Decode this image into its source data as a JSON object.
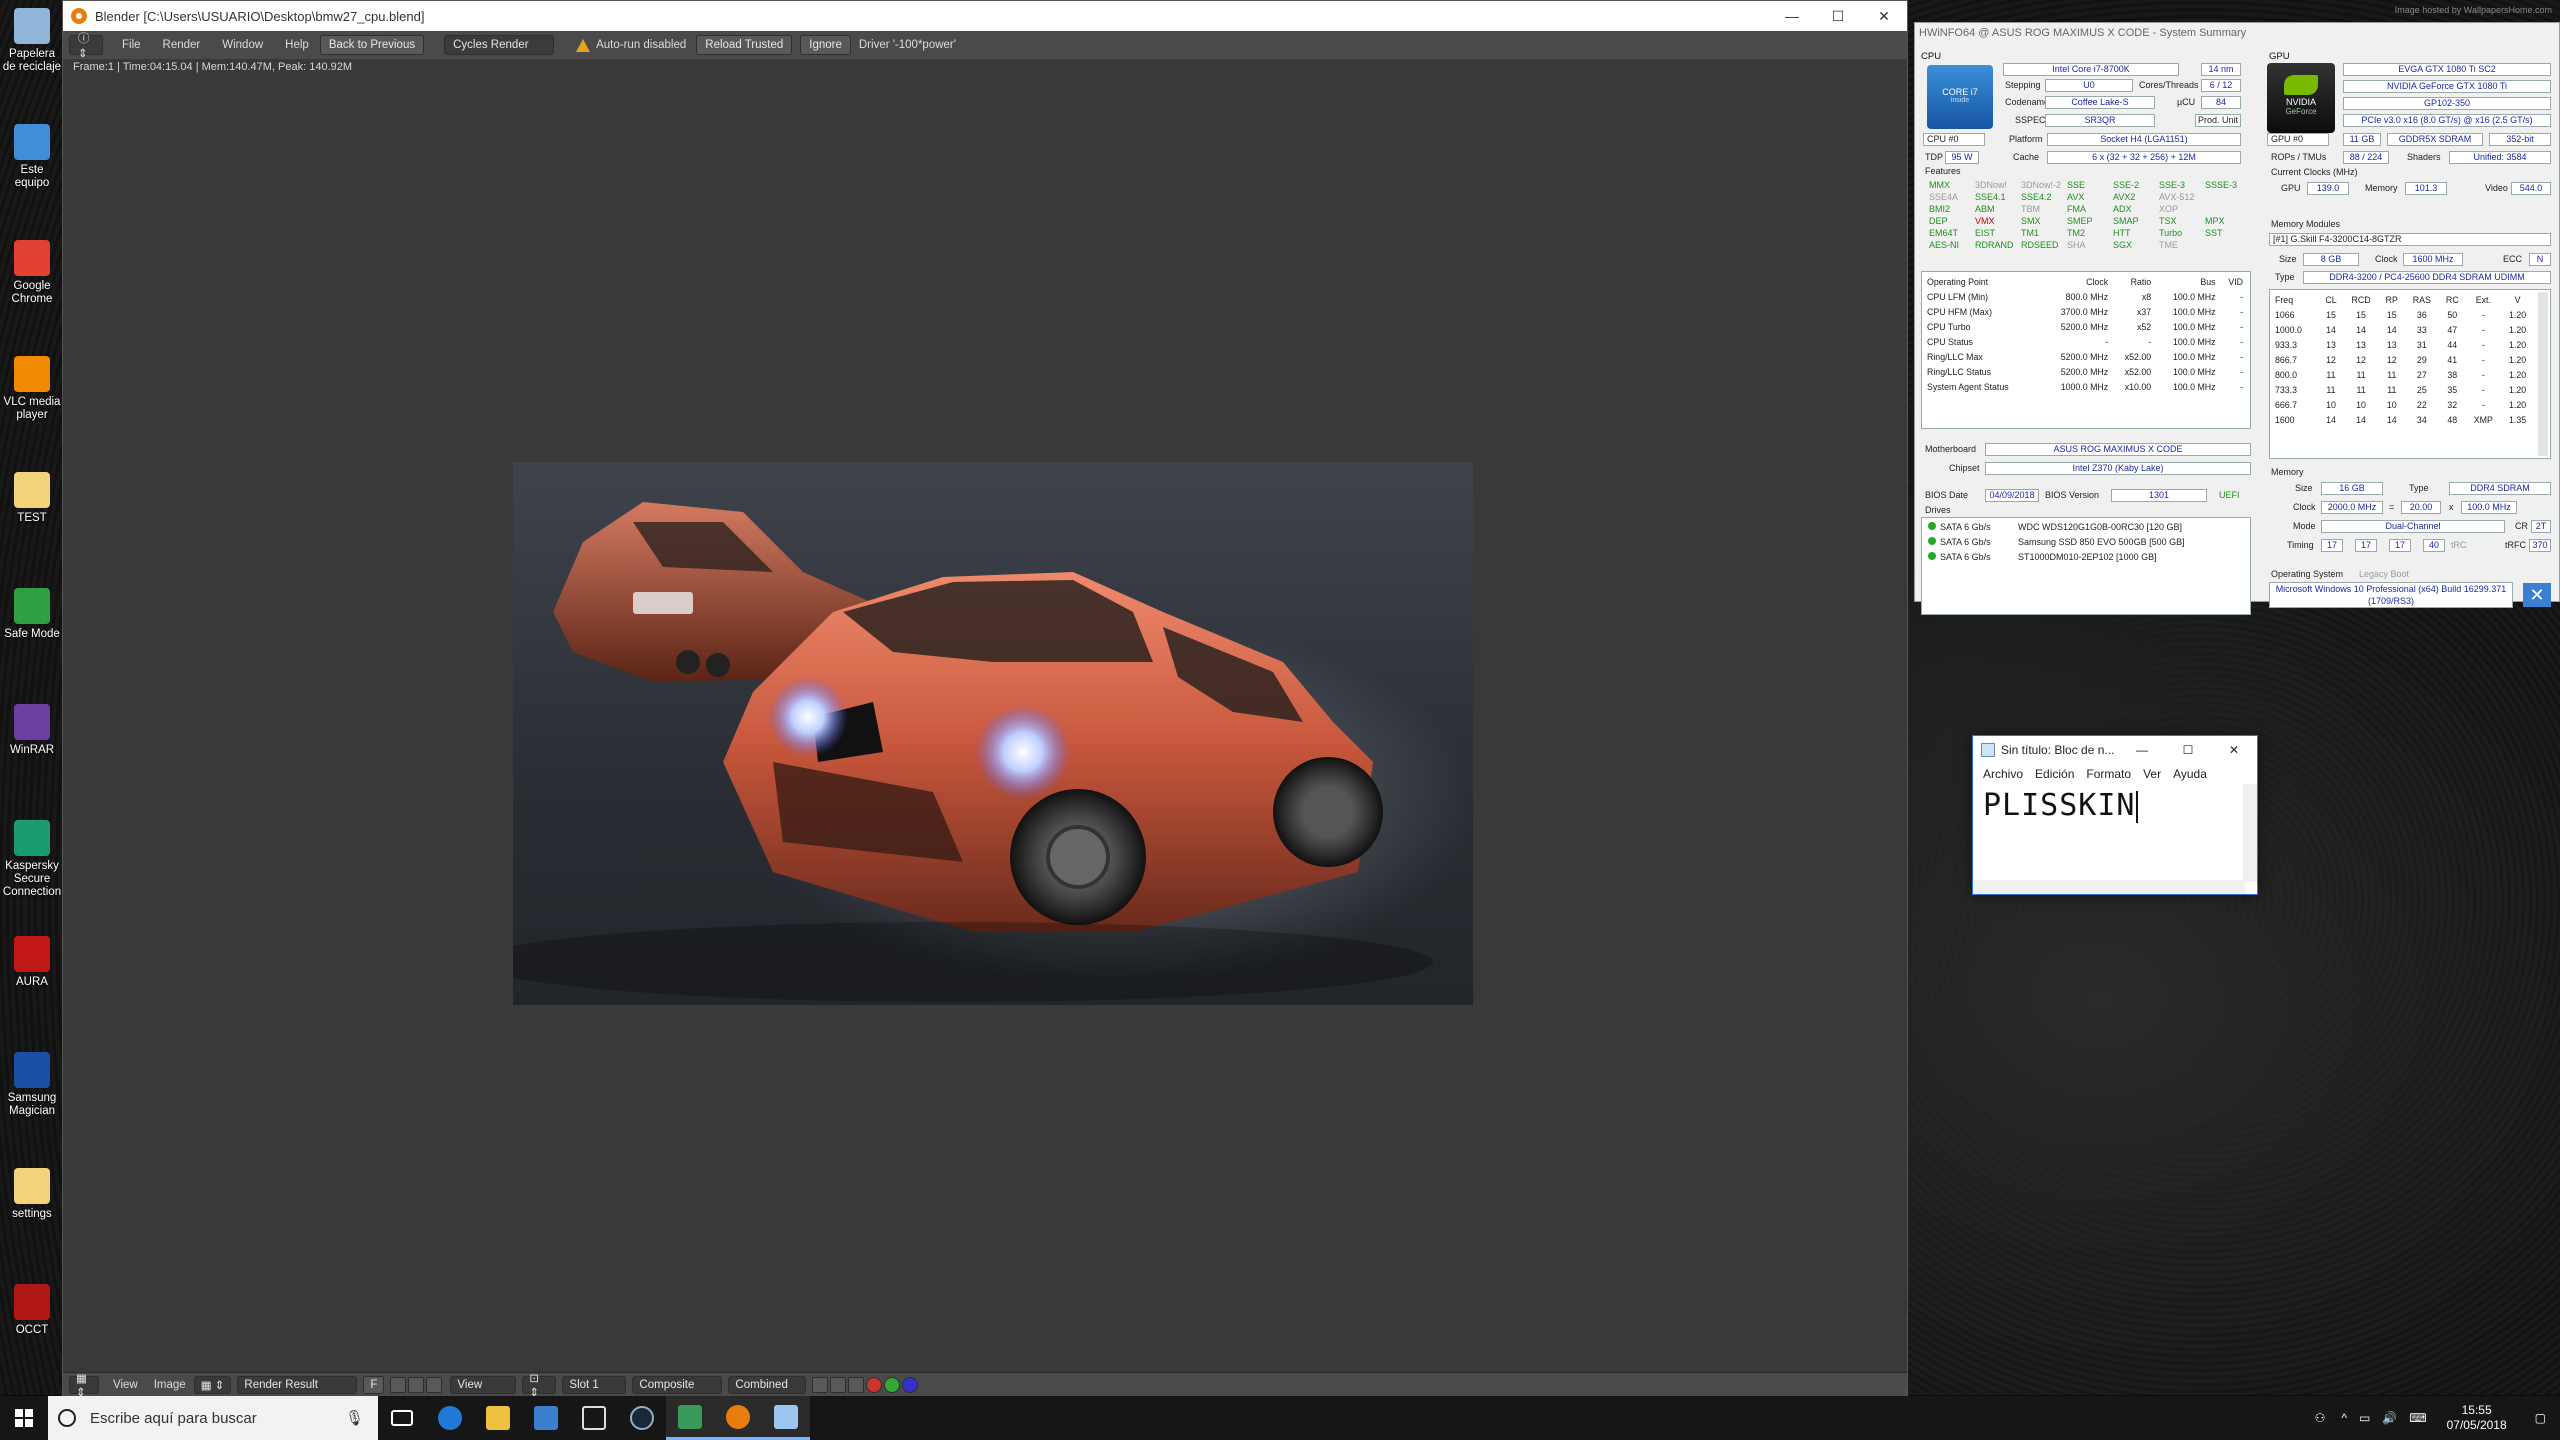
{
  "desktop": {
    "icons": [
      {
        "label": "Papelera de reciclaje",
        "color": "#8fb6d8"
      },
      {
        "label": "Este equipo",
        "color": "#3f8fd8"
      },
      {
        "label": "Google Chrome",
        "color": "#e34133"
      },
      {
        "label": "VLC media player",
        "color": "#f08a00"
      },
      {
        "label": "TEST",
        "color": "#f2d37a"
      },
      {
        "label": "Safe Mode",
        "color": "#2ea043"
      },
      {
        "label": "WinRAR",
        "color": "#6b3fa0"
      },
      {
        "label": "Kaspersky Secure Connection",
        "color": "#1b9c6e"
      },
      {
        "label": "AURA",
        "color": "#c21818"
      },
      {
        "label": "Samsung Magician",
        "color": "#1a4fa3"
      },
      {
        "label": "settings",
        "color": "#f2d37a"
      },
      {
        "label": "OCCT",
        "color": "#b01818"
      }
    ],
    "watermark": "Image hosted by WallpapersHome.com"
  },
  "blender": {
    "title": "Blender [C:\\Users\\USUARIO\\Desktop\\bmw27_cpu.blend]",
    "menu": [
      "File",
      "Render",
      "Window",
      "Help"
    ],
    "back_label": "Back to Previous",
    "engine": "Cycles Render",
    "autorun": "Auto-run disabled",
    "reload": "Reload Trusted",
    "ignore": "Ignore",
    "driver": "Driver '-100*power'",
    "info": "Frame:1 | Time:04:15.04 | Mem:140.47M, Peak: 140.92M",
    "bottom": {
      "view": "View",
      "image": "Image",
      "result": "Render Result",
      "f": "F",
      "view2": "View",
      "slot": "Slot 1",
      "composite": "Composite",
      "combined": "Combined"
    }
  },
  "hwinfo": {
    "title": "HWiNFO64 @ ASUS ROG MAXIMUS X CODE - System Summary",
    "cpu_label": "CPU",
    "gpu_label": "GPU",
    "cpu": {
      "name": "Intel Core i7-8700K",
      "nm": "14 nm",
      "stepping_l": "Stepping",
      "stepping": "U0",
      "cores_l": "Cores/Threads",
      "cores": "6 / 12",
      "codename_l": "Codename",
      "codename": "Coffee Lake-S",
      "ucu_l": "µCU",
      "ucu": "84",
      "sspec_l": "SSPEC",
      "sspec": "SR3QR",
      "prod": "Prod. Unit",
      "platform_l": "Platform",
      "platform": "Socket H4 (LGA1151)",
      "cpu_sel": "CPU #0",
      "tdp_l": "TDP",
      "tdp": "95 W",
      "cache_l": "Cache",
      "cache": "6 x (32 + 32 + 256) + 12M",
      "features_l": "Features",
      "badge1": "CORE i7",
      "badge2": "inside"
    },
    "features": [
      [
        [
          "MMX",
          "on"
        ],
        [
          "3DNow!",
          "off"
        ],
        [
          "3DNow!-2",
          "off"
        ],
        [
          "SSE",
          "on"
        ],
        [
          "SSE-2",
          "on"
        ],
        [
          "SSE-3",
          "on"
        ],
        [
          "SSSE-3",
          "on"
        ]
      ],
      [
        [
          "SSE4A",
          "off"
        ],
        [
          "SSE4.1",
          "on"
        ],
        [
          "SSE4.2",
          "on"
        ],
        [
          "AVX",
          "on"
        ],
        [
          "AVX2",
          "on"
        ],
        [
          "AVX-512",
          "off"
        ],
        [
          "",
          ""
        ]
      ],
      [
        [
          "BMI2",
          "on"
        ],
        [
          "ABM",
          "on"
        ],
        [
          "TBM",
          "off"
        ],
        [
          "FMA",
          "on"
        ],
        [
          "ADX",
          "on"
        ],
        [
          "XOP",
          "off"
        ],
        [
          "",
          ""
        ]
      ],
      [
        [
          "DEP",
          "on"
        ],
        [
          "VMX",
          "red"
        ],
        [
          "SMX",
          "on"
        ],
        [
          "SMEP",
          "on"
        ],
        [
          "SMAP",
          "on"
        ],
        [
          "TSX",
          "on"
        ],
        [
          "MPX",
          "on"
        ]
      ],
      [
        [
          "EM64T",
          "on"
        ],
        [
          "EIST",
          "on"
        ],
        [
          "TM1",
          "on"
        ],
        [
          "TM2",
          "on"
        ],
        [
          "HTT",
          "on"
        ],
        [
          "Turbo",
          "on"
        ],
        [
          "SST",
          "on"
        ]
      ],
      [
        [
          "AES-NI",
          "on"
        ],
        [
          "RDRAND",
          "on"
        ],
        [
          "RDSEED",
          "on"
        ],
        [
          "SHA",
          "off"
        ],
        [
          "SGX",
          "on"
        ],
        [
          "TME",
          "off"
        ],
        [
          "",
          ""
        ]
      ]
    ],
    "op_head": [
      "Operating Point",
      "Clock",
      "Ratio",
      "Bus",
      "VID"
    ],
    "op_rows": [
      [
        "CPU LFM (Min)",
        "800.0 MHz",
        "x8",
        "100.0 MHz",
        "-"
      ],
      [
        "CPU HFM (Max)",
        "3700.0 MHz",
        "x37",
        "100.0 MHz",
        "-"
      ],
      [
        "CPU Turbo",
        "5200.0 MHz",
        "x52",
        "100.0 MHz",
        "-"
      ],
      [
        "CPU Status",
        "-",
        "-",
        "100.0 MHz",
        "-"
      ],
      [
        "Ring/LLC Max",
        "5200.0 MHz",
        "x52.00",
        "100.0 MHz",
        "-"
      ],
      [
        "Ring/LLC Status",
        "5200.0 MHz",
        "x52.00",
        "100.0 MHz",
        "-"
      ],
      [
        "System Agent Status",
        "1000.0 MHz",
        "x10.00",
        "100.0 MHz",
        "-"
      ]
    ],
    "mb_l": "Motherboard",
    "mb": "ASUS ROG MAXIMUS X CODE",
    "chipset_l": "Chipset",
    "chipset": "Intel Z370 (Kaby Lake)",
    "bios_date_l": "BIOS Date",
    "bios_date": "04/09/2018",
    "bios_ver_l": "BIOS Version",
    "bios_ver": "1301",
    "uefi": "UEFI",
    "drives_l": "Drives",
    "drives": [
      [
        "SATA 6 Gb/s",
        "WDC WDS120G1G0B-00RC30 [120 GB]"
      ],
      [
        "SATA 6 Gb/s",
        "Samsung SSD 850 EVO 500GB [500 GB]"
      ],
      [
        "SATA 6 Gb/s",
        "ST1000DM010-2EP102 [1000 GB]"
      ]
    ],
    "gpu": {
      "board": "EVGA GTX 1080 Ti SC2",
      "name": "NVIDIA GeForce GTX 1080 Ti",
      "chip": "GP102-350",
      "pcie": "PCIe v3.0 x16 (8.0 GT/s) @ x16 (2.5 GT/s)",
      "sel": "GPU #0",
      "mem": "11 GB",
      "memtype": "GDDR5X SDRAM",
      "bus": "352-bit",
      "rops_l": "ROPs / TMUs",
      "rops": "88 / 224",
      "shaders_l": "Shaders",
      "shaders": "Unified: 3584",
      "clocks_l": "Current Clocks (MHz)",
      "gpu_l": "GPU",
      "gpu_clk": "139.0",
      "mem_l": "Memory",
      "mem_clk": "101.3",
      "video_l": "Video",
      "video_clk": "544.0",
      "logo1": "NVIDIA",
      "logo2": "GeForce"
    },
    "modules_l": "Memory Modules",
    "module": "[#1] G.Skill F4-3200C14-8GTZR",
    "mod_size_l": "Size",
    "mod_size": "8 GB",
    "mod_clock_l": "Clock",
    "mod_clock": "1600 MHz",
    "ecc_l": "ECC",
    "ecc": "N",
    "mod_type_l": "Type",
    "mod_type": "DDR4-3200 / PC4-25600 DDR4 SDRAM UDIMM",
    "timing_head": [
      "Freq",
      "CL",
      "RCD",
      "RP",
      "RAS",
      "RC",
      "Ext.",
      "V"
    ],
    "timing_rows": [
      [
        "1066",
        "15",
        "15",
        "15",
        "36",
        "50",
        "-",
        "1.20"
      ],
      [
        "1000.0",
        "14",
        "14",
        "14",
        "33",
        "47",
        "-",
        "1.20"
      ],
      [
        "933.3",
        "13",
        "13",
        "13",
        "31",
        "44",
        "-",
        "1.20"
      ],
      [
        "866.7",
        "12",
        "12",
        "12",
        "29",
        "41",
        "-",
        "1.20"
      ],
      [
        "800.0",
        "11",
        "11",
        "11",
        "27",
        "38",
        "-",
        "1.20"
      ],
      [
        "733.3",
        "11",
        "11",
        "11",
        "25",
        "35",
        "-",
        "1.20"
      ],
      [
        "666.7",
        "10",
        "10",
        "10",
        "22",
        "32",
        "-",
        "1.20"
      ],
      [
        "1600",
        "14",
        "14",
        "14",
        "34",
        "48",
        "XMP",
        "1.35"
      ]
    ],
    "memory_l": "Memory",
    "mem_size_l": "Size",
    "mem_size": "16 GB",
    "mem_type_l": "Type",
    "mem_type": "DDR4 SDRAM",
    "mem_clock_l": "Clock",
    "mem_clock": "2000.0 MHz",
    "eq": "=",
    "mult": "20.00",
    "x": "x",
    "mem_bus": "100.0 MHz",
    "mode_l": "Mode",
    "mode": "Dual-Channel",
    "cr_l": "CR",
    "cr": "2T",
    "timing_l": "Timing",
    "t1": "17",
    "t2": "17",
    "t3": "17",
    "t4": "40",
    "trc": "tRC",
    "trfc_l": "tRFC",
    "trfc": "370",
    "os_l": "Operating System",
    "legacy": "Legacy Boot",
    "os": "Microsoft Windows 10 Professional (x64) Build 16299.371 (1709/RS3)"
  },
  "notepad": {
    "title": "Sin título: Bloc de n...",
    "menu": [
      "Archivo",
      "Edición",
      "Formato",
      "Ver",
      "Ayuda"
    ],
    "text": "PLISSKIN"
  },
  "taskbar": {
    "search": "Escribe aquí para buscar",
    "time": "15:55",
    "date": "07/05/2018"
  }
}
